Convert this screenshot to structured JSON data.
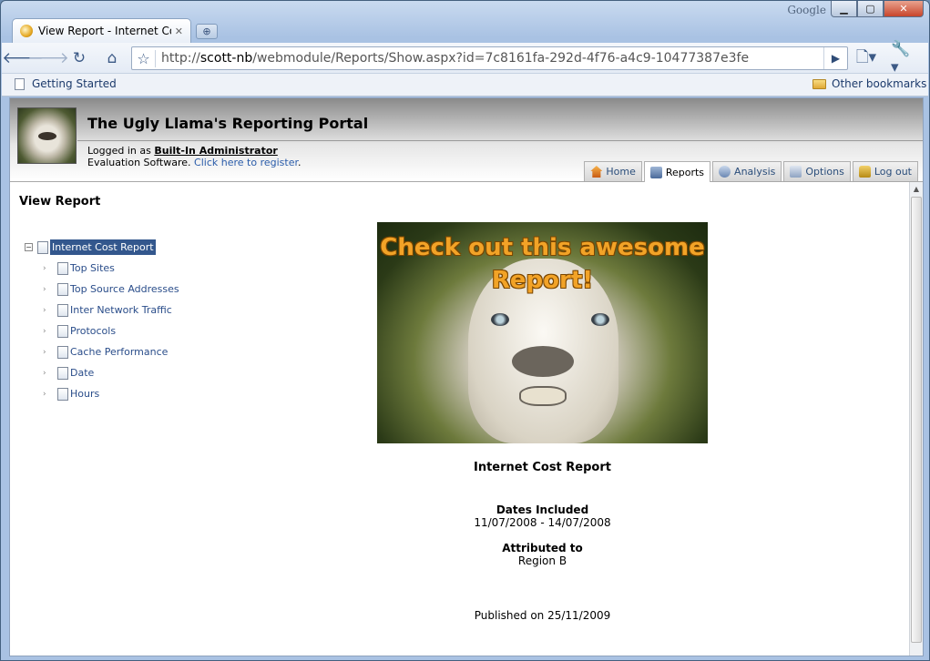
{
  "browser": {
    "brand": "Google",
    "tab_title": "View Report - Internet Co...",
    "url_prefix": "http://",
    "url_host": "scott-nb",
    "url_path": "/webmodule/Reports/Show.aspx?id=7c8161fa-292d-4f76-a4c9-10477387e3fe",
    "bookmarks": {
      "getting_started": "Getting Started",
      "other": "Other bookmarks"
    }
  },
  "header": {
    "title": "The Ugly Llama's Reporting Portal",
    "logged_in_prefix": "Logged in as ",
    "user": "Built-In Administrator",
    "eval_prefix": "Evaluation Software. ",
    "register_link": "Click here to register",
    "eval_suffix": "."
  },
  "nav_tabs": [
    {
      "label": "Home",
      "icon": "home-icon"
    },
    {
      "label": "Reports",
      "icon": "reports-icon",
      "active": true
    },
    {
      "label": "Analysis",
      "icon": "analysis-icon"
    },
    {
      "label": "Options",
      "icon": "options-icon"
    },
    {
      "label": "Log out",
      "icon": "lock-icon"
    }
  ],
  "page": {
    "title": "View Report"
  },
  "tree": {
    "root": "Internet Cost Report",
    "children": [
      "Top Sites",
      "Top Source Addresses",
      "Inter Network Traffic",
      "Protocols",
      "Cache Performance",
      "Date",
      "Hours"
    ]
  },
  "banner": {
    "line1": "Check out this awesome",
    "line2": "Report!"
  },
  "report": {
    "title": "Internet Cost Report",
    "dates_label": "Dates Included",
    "dates_value": "11/07/2008 - 14/07/2008",
    "attributed_label": "Attributed to",
    "attributed_value": "Region B",
    "published": "Published on 25/11/2009"
  }
}
